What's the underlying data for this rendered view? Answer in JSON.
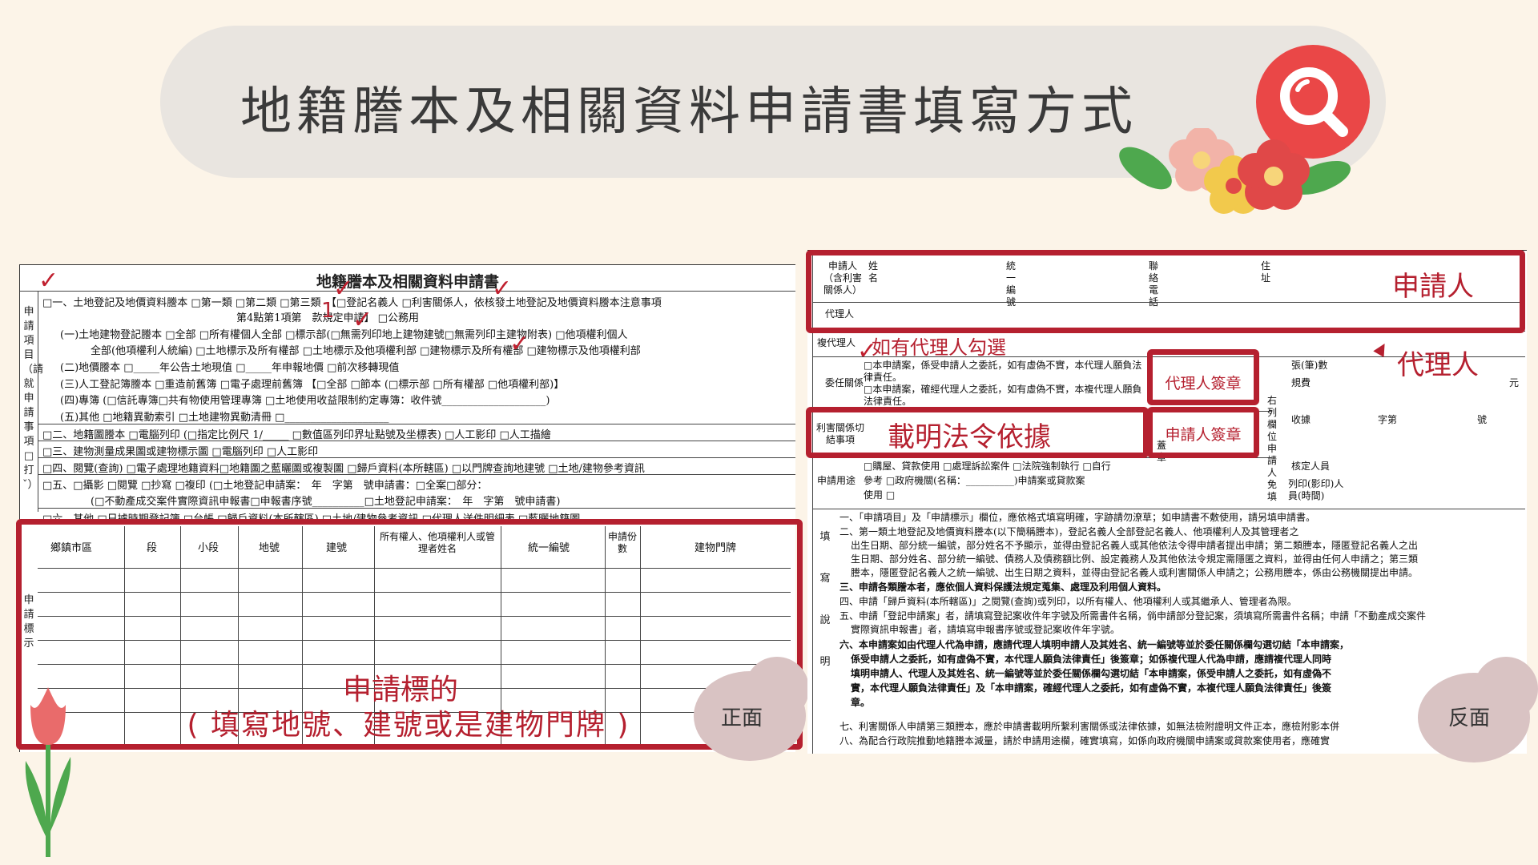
{
  "page": {
    "title": "地籍謄本及相關資料申請書填寫方式",
    "side_labels": {
      "front": "正面",
      "back": "反面"
    }
  },
  "front_form": {
    "title": "地籍謄本及相關資料申請書",
    "items_label": "申請項目（請就申請事項□打ˇ）",
    "lines": [
      "□一、土地登記及地價資料謄本 □第一類 □第二類 □第三類　【□登記名義人 □利害關係人，依核發土地登記及地價資料謄本注意事項",
      "第4點第1項第　款規定申請】 □公務用",
      "(一)土地建物登記謄本 □全部 □所有權個人全部 □標示部(□無需列印地上建物建號□無需列印主建物附表) □他項權利個人",
      "全部(他項權利人統編) □土地標示及所有權部 □土地標示及他項權利部 □建物標示及所有權部 □建物標示及他項權利部",
      "(二)地價謄本 □_____年公告土地現值 □_____年申報地價 □前次移轉現值",
      "(三)人工登記簿謄本 □重造前舊簿 □電子處理前舊簿 【□全部 □節本 (□標示部 □所有權部 □他項權利部)】",
      "(四)專簿 (□信託專簿□共有物使用管理專簿 □土地使用收益限制約定專簿：收件號____________________)",
      "(五)其他 □地籍異動索引 □土地建物異動清冊 □____________________",
      "□二、地籍圖謄本 □電腦列印 (□指定比例尺 1/_____ □數值區列印界址點號及坐標表) □人工影印 □人工描繪",
      "□三、建物測量成果圖或建物標示圖 □電腦列印 □人工影印",
      "□四、閱覽(查詢) □電子處理地籍資料□地籍圖之藍曬圖或複製圖 □歸戶資料(本所轄區) □以門牌查詢地建號 □土地/建物參考資訊",
      "□五、□攝影 □閱覽 □抄寫 □複印 (□土地登記申請案：　年　字第　號申請書：□全案□部分：",
      "(□不動產成交案件實際資訊申報書□申報書序號__________□土地登記申請案：　年　字第　號申請書)",
      "□六、其他 □日據時期登記簿 □台帳 □歸戶資料(本所轄區) □土地/建物參考資訊 □代理人送件明細表 □藍曬地籍圖"
    ],
    "table_side_label": "申請標示",
    "table_headers": [
      "鄉鎮市區",
      "段",
      "小段",
      "地號",
      "建號",
      "所有權人、他項權利人或管理者姓名",
      "統一編號",
      "申請份數",
      "建物門牌"
    ],
    "note": "1"
  },
  "back_form": {
    "rows": {
      "applicant": "申請人（含利害關係人）",
      "applicant_name": "姓名",
      "applicant_id": "統一編號",
      "applicant_contact": "聯絡電話",
      "applicant_addr": "住址",
      "agent": "代理人",
      "sub_agent": "複代理人",
      "delegation": "委任關係",
      "delegation_text_1": "□本申請案，係受申請人之委託，如有虛偽不實，本代理人願負法律責任。",
      "delegation_text_2": "□本申請案，確經代理人之委託，如有虛偽不實，本複代理人願負法律責任。",
      "interest": "利害關係切結事項",
      "purpose": "申請用途",
      "purpose_text_1": "□購屋、貸款使用 □處理訴訟案件 □法院強制執行 □自行",
      "purpose_text_2": "參考 □政府機關(名稱：__________)申請案或貸款案",
      "purpose_text_3": "使用 □",
      "signature_label": "蓋章",
      "right_col_label": "右列欄位申請人免填",
      "fee_rows": [
        "張(筆)數",
        "規費",
        "收據",
        "核定人員",
        "列印(影印)人員(時間)"
      ],
      "fee_unit": "元",
      "receipt_cols": [
        "字第",
        "號"
      ]
    },
    "notes_label": "填寫說明",
    "notes": [
      "一、「申請項目」及「申請標示」欄位，應依格式填寫明確，字跡請勿潦草；如申請書不敷使用，請另填申請書。",
      "二、第一類土地登記及地價資料謄本(以下簡稱謄本)，登記名義人全部登記名義人、他項權利人及其管理者之",
      "出生日期、部分統一編號，部分姓名不予顯示，並得由登記名義人或其他依法令得申請者提出申請；第二類謄本，隱匿登記名義人之出",
      "生日期、部分姓名、部分統一編號、債務人及債務額比例、設定義務人及其他依法令規定需隱匿之資料，並得由任何人申請之；第三類",
      "謄本，隱匿登記名義人之統一編號、出生日期之資料，並得由登記名義人或利害關係人申請之；公務用謄本，係由公務機關提出申請。",
      "三、申請各類謄本者，應依個人資料保護法規定蒐集、處理及利用個人資料。",
      "四、申請「歸戶資料(本所轄區)」之閱覽(查詢)或列印，以所有權人、他項權利人或其繼承人、管理者為限。",
      "五、申請「登記申請案」者，請填寫登記案收件年字號及所需書件名稱，倘申請部分登記案，須填寫所需書件名稱；申請「不動產成交案件",
      "實際資訊申報書」者，請填寫申報書序號或登記案收件年字號。",
      "六、本申請案如由代理人代為申請，應請代理人填明申請人及其姓名、統一編號等並於委任關係欄勾選切結「本申請案，",
      "係受申請人之委託，如有虛偽不實，本代理人願負法律責任」後簽章；如係複代理人代為申請，應請複代理人同時",
      "填明申請人、代理人及其姓名、統一編號等並於委任關係欄勾選切結「本申請案，係受申請人之委託，如有虛偽不",
      "實，本代理人願負法律責任」及「本申請案，確經代理人之委託，如有虛偽不實，本複代理人願負法律責任」後簽",
      "章。",
      "七、利害關係人申請第三類謄本，應於申請書載明所繫利害關係或法律依據，如無法檢附證明文件正本，應檢附影本併",
      "八、為配合行政院推動地籍謄本減量，請於申請用途欄，確實填寫，如係向政府機關申請案或貸款案使用者，應確實"
    ]
  },
  "annotations": {
    "applicant": "申請人",
    "agent": "代理人",
    "agent_check_hint": "如有代理人勾選",
    "agent_seal": "代理人簽章",
    "applicant_seal": "申請人簽章",
    "legal_basis": "載明法令依據",
    "target_line1": "申請標的",
    "target_line2": "( 填寫地號、建號或是建物門牌 )",
    "check_mark": "✓"
  },
  "colors": {
    "background": "#fcf4e8",
    "accent_red": "#b5202f",
    "search_red": "#ea4747",
    "pill": "#e9e5e0"
  }
}
